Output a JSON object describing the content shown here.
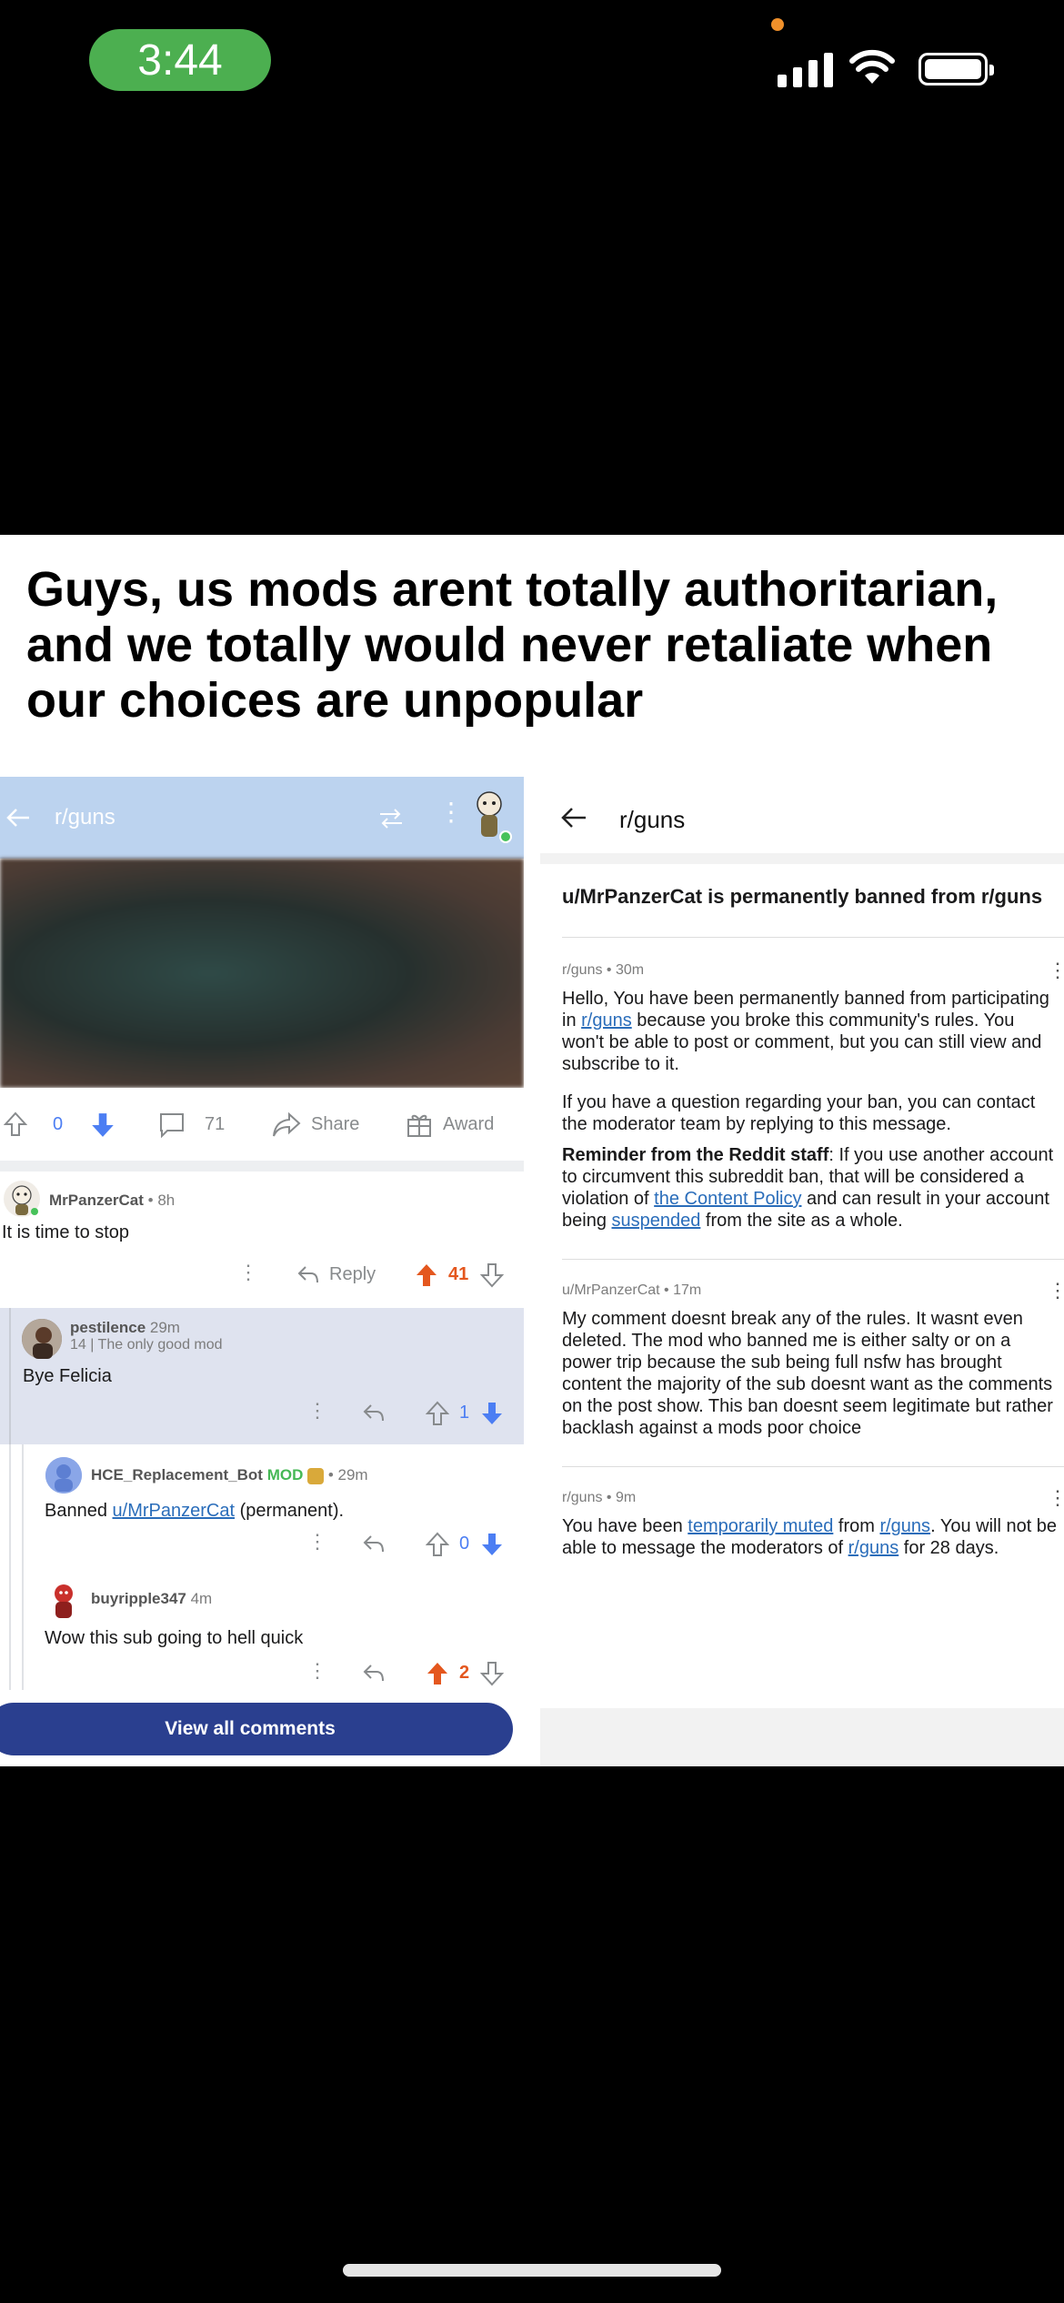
{
  "status_bar": {
    "time": "3:44"
  },
  "caption": "Guys, us mods arent totally authoritarian, and we totally would never retaliate when our choices are unpopular",
  "left_screenshot": {
    "header_title": "r/guns",
    "post_actions": {
      "score": "0",
      "comments": "71",
      "share": "Share",
      "award": "Award"
    },
    "comments": [
      {
        "author": "MrPanzerCat",
        "meta": " • 8h",
        "text": "It is time to stop",
        "reply_label": "Reply",
        "score": "41"
      },
      {
        "author": "pestilence",
        "meta": " 29m",
        "flair": "14 | The only good mod",
        "text": "Bye Felicia",
        "score": "1"
      },
      {
        "author": "HCE_Replacement_Bot",
        "badge": "MOD",
        "meta": " • 29m",
        "text_prefix": "Banned ",
        "link": "u/MrPanzerCat",
        "text_suffix": " (permanent).",
        "score": "0"
      },
      {
        "author": "buyripple347",
        "meta": " 4m",
        "text": "Wow this sub going to hell quick",
        "score": "2"
      }
    ],
    "view_all": "View all comments"
  },
  "right_screenshot": {
    "header_title": "r/guns",
    "subject": "u/MrPanzerCat is permanently banned from r/guns",
    "messages": [
      {
        "meta": "r/guns • 30m",
        "p1_a": "Hello, You have been permanently banned from participating in ",
        "p1_link": "r/guns",
        "p1_b": " because you broke this community's rules. You won't be able to post or comment, but you can still view and subscribe to it.",
        "p2": "If you have a question regarding your ban, you can contact the moderator team by replying to this message.",
        "p3_bold": "Reminder from the Reddit staff",
        "p3_a": ": If you use another account to circumvent this subreddit ban, that will be considered a violation of ",
        "p3_link1": "the Content Policy",
        "p3_b": " and can result in your account being ",
        "p3_link2": "suspended",
        "p3_c": " from the site as a whole."
      },
      {
        "meta": "u/MrPanzerCat • 17m",
        "text": "My comment doesnt break any of the rules. It wasnt even deleted. The mod who banned me is either salty or on a power trip because the sub being full nsfw has brought content the majority of the sub doesnt want as the comments on the post show. This ban doesnt seem legitimate but rather backlash against a mods poor choice"
      },
      {
        "meta": "r/guns • 9m",
        "t_a": "You have been ",
        "t_link1": "temporarily muted",
        "t_b": " from ",
        "t_link2": "r/guns",
        "t_c": ". You will not be able to message the moderators of ",
        "t_link3": "r/guns",
        "t_d": " for 28 days."
      }
    ]
  },
  "colors": {
    "upvote": "#e4571e",
    "downvote": "#4c7ef3",
    "header": "#bcd3ef",
    "button": "#2a3f8f"
  }
}
